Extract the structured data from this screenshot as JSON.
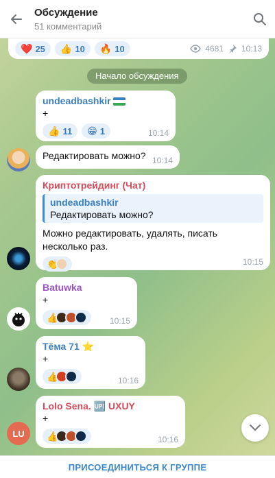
{
  "header": {
    "title": "Обсуждение",
    "subtitle": "51 комментарий"
  },
  "post": {
    "reactions": [
      {
        "icon": "heart-icon",
        "emoji": "❤️",
        "count": "25"
      },
      {
        "icon": "thumbs-up-icon",
        "emoji": "👍",
        "count": "10"
      },
      {
        "icon": "fire-icon",
        "emoji": "🔥",
        "count": "10"
      }
    ],
    "views": "4681",
    "time": "10:13"
  },
  "date_pill": "Начало обсуждения",
  "messages": [
    {
      "author": "undeadbashkir",
      "author_color": "#3a7fc2",
      "text": "+",
      "reactions": [
        {
          "emoji": "👍",
          "count": "11"
        },
        {
          "emoji": "😁",
          "count": "1"
        }
      ],
      "time": "10:14"
    },
    {
      "text": "Редактировать можно?",
      "time": "10:14"
    },
    {
      "author": "Криптотрейдинг (Чат)",
      "author_color": "#d54b5b",
      "quote": {
        "author": "undeadbashkir",
        "text": "Редактировать можно?"
      },
      "text": "Можно редактировать, удалять, писать несколько раз.",
      "time": "10:15"
    },
    {
      "author": "Batuwka",
      "author_color": "#9b52c4",
      "text": "+",
      "time": "10:15"
    },
    {
      "author": "Тёма 71 ⭐",
      "author_color": "#3a7fc2",
      "text": "+",
      "time": "10:16"
    },
    {
      "author": "Lolo Sena. 🆙 UXUY",
      "author_color": "#d54b5b",
      "text": "+",
      "time": "10:16",
      "avatar_initials": "LU"
    }
  ],
  "footer": {
    "join_label": "ПРИСОЕДИНИТЬСЯ К ГРУППЕ"
  },
  "colors": {
    "accent": "#3a86c8",
    "reaction_bg": "#e6f0fb"
  }
}
